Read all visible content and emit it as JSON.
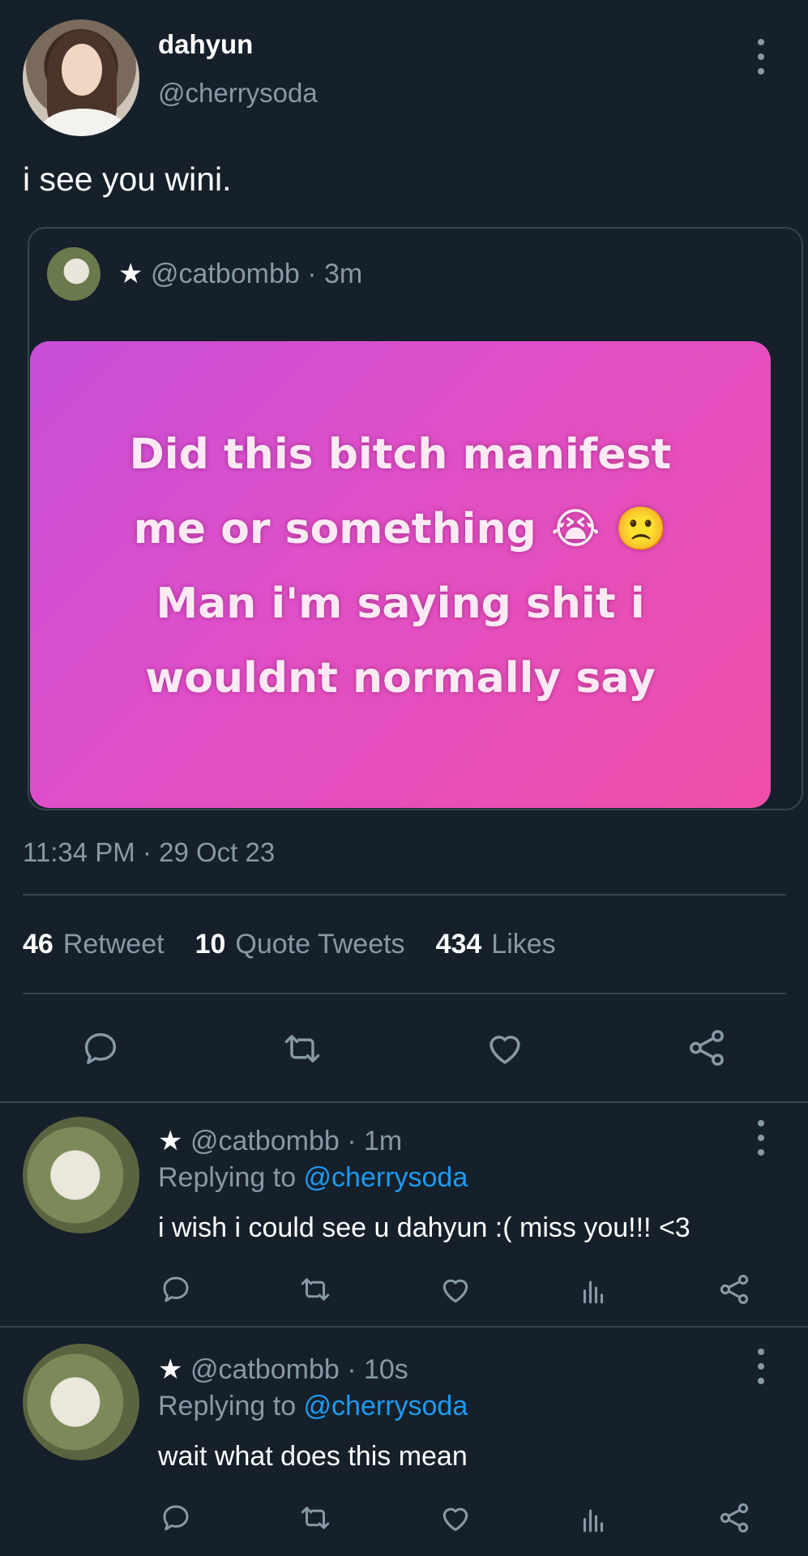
{
  "tweet": {
    "display_name": "dahyun",
    "handle": "@cherrysoda",
    "text": "i see you wini.",
    "quote": {
      "star": "★",
      "meta": "@catbombb · 3m",
      "image_text_lines": [
        "Did this bitch manifest",
        "me or something 😭 🙁",
        "Man i'm saying shit i",
        "wouldnt normally say"
      ]
    },
    "timestamp": "11:34 PM · 29 Oct 23",
    "stats": {
      "retweets": "46",
      "retweets_label": "Retweet",
      "quotes": "10",
      "quotes_label": "Quote Tweets",
      "likes": "434",
      "likes_label": "Likes"
    }
  },
  "replies": [
    {
      "star": "★",
      "meta": "@catbombb · 1m",
      "replying_prefix": "Replying to ",
      "replying_mention": "@cherrysoda",
      "text": "i wish i could see u dahyun :( miss you!!! <3"
    },
    {
      "star": "★",
      "meta": "@catbombb · 10s",
      "replying_prefix": "Replying to ",
      "replying_mention": "@cherrysoda",
      "text": "wait what does this mean"
    }
  ],
  "icons": {
    "reply": "reply-icon",
    "retweet": "retweet-icon",
    "like": "heart-icon",
    "share": "share-icon",
    "analytics": "analytics-icon",
    "more": "more-icon"
  },
  "colors": {
    "background": "#15202b",
    "muted": "#8899a6",
    "link": "#1d9bf0",
    "border": "#38444d"
  }
}
